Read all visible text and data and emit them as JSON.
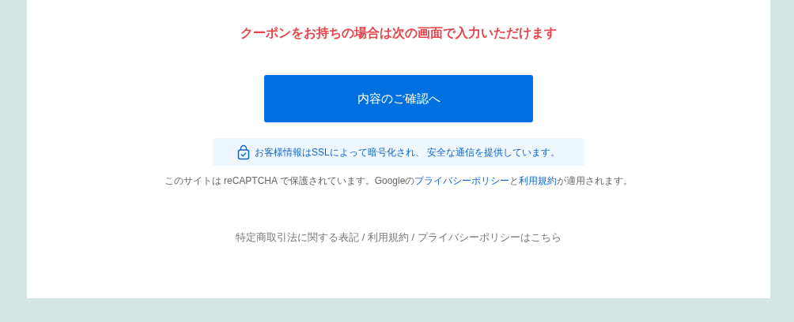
{
  "coupon_notice": "クーポンをお持ちの場合は次の画面で入力いただけます",
  "confirm_button": "内容のご確認へ",
  "ssl_note": "お客様情報はSSLによって暗号化され、 安全な通信を提供しています。",
  "recaptcha_note": [
    {
      "kind": "text",
      "text": "このサイトは reCAPTCHA で保護されています。Googleの"
    },
    {
      "kind": "link",
      "text": "プライバシーポリシー"
    },
    {
      "kind": "text",
      "text": "と"
    },
    {
      "kind": "link",
      "text": "利用規約"
    },
    {
      "kind": "text",
      "text": "が適用されます。"
    }
  ],
  "footer_link": "特定商取引法に関する表記 / 利用規約 / プライバシーポリシーはこちら"
}
